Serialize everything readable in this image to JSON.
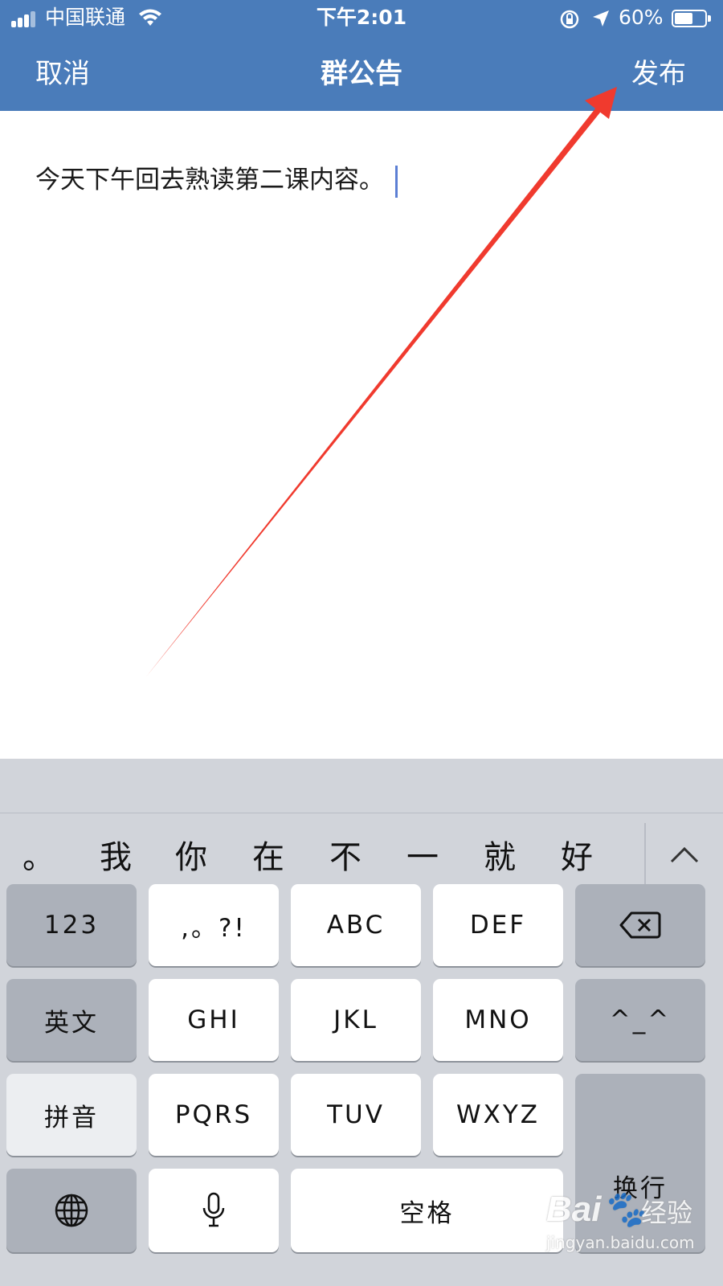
{
  "status_bar": {
    "carrier": "中国联通",
    "time": "下午2:01",
    "battery": "60%",
    "battery_level": 0.6,
    "icons": [
      "cellular-signal-icon",
      "wifi-icon",
      "rotation-lock-icon",
      "location-icon",
      "battery-icon"
    ]
  },
  "nav": {
    "cancel": "取消",
    "title": "群公告",
    "publish": "发布"
  },
  "editor": {
    "text": "今天下午回去熟读第二课内容。"
  },
  "annotation": {
    "color": "#f03a2e"
  },
  "keyboard": {
    "candidates": [
      "。",
      "我",
      "你",
      "在",
      "不",
      "一",
      "就",
      "好"
    ],
    "keys": {
      "numbers": "123",
      "punct": ",。?!",
      "abc": "ABC",
      "def": "DEF",
      "english": "英文",
      "ghi": "GHI",
      "jkl": "JKL",
      "mno": "MNO",
      "emoticon": "^_^",
      "pinyin": "拼音",
      "pqrs": "PQRS",
      "tuv": "TUV",
      "wxyz": "WXYZ",
      "return": "换行",
      "space": "空格"
    }
  },
  "watermark": {
    "logo": "Bai",
    "logo_suffix": "经验",
    "url": "jingyan.baidu.com"
  },
  "colors": {
    "header": "#4a7cba",
    "keyboard_bg": "#d1d4da",
    "key_white": "#ffffff",
    "key_gray": "#acb1ba"
  }
}
